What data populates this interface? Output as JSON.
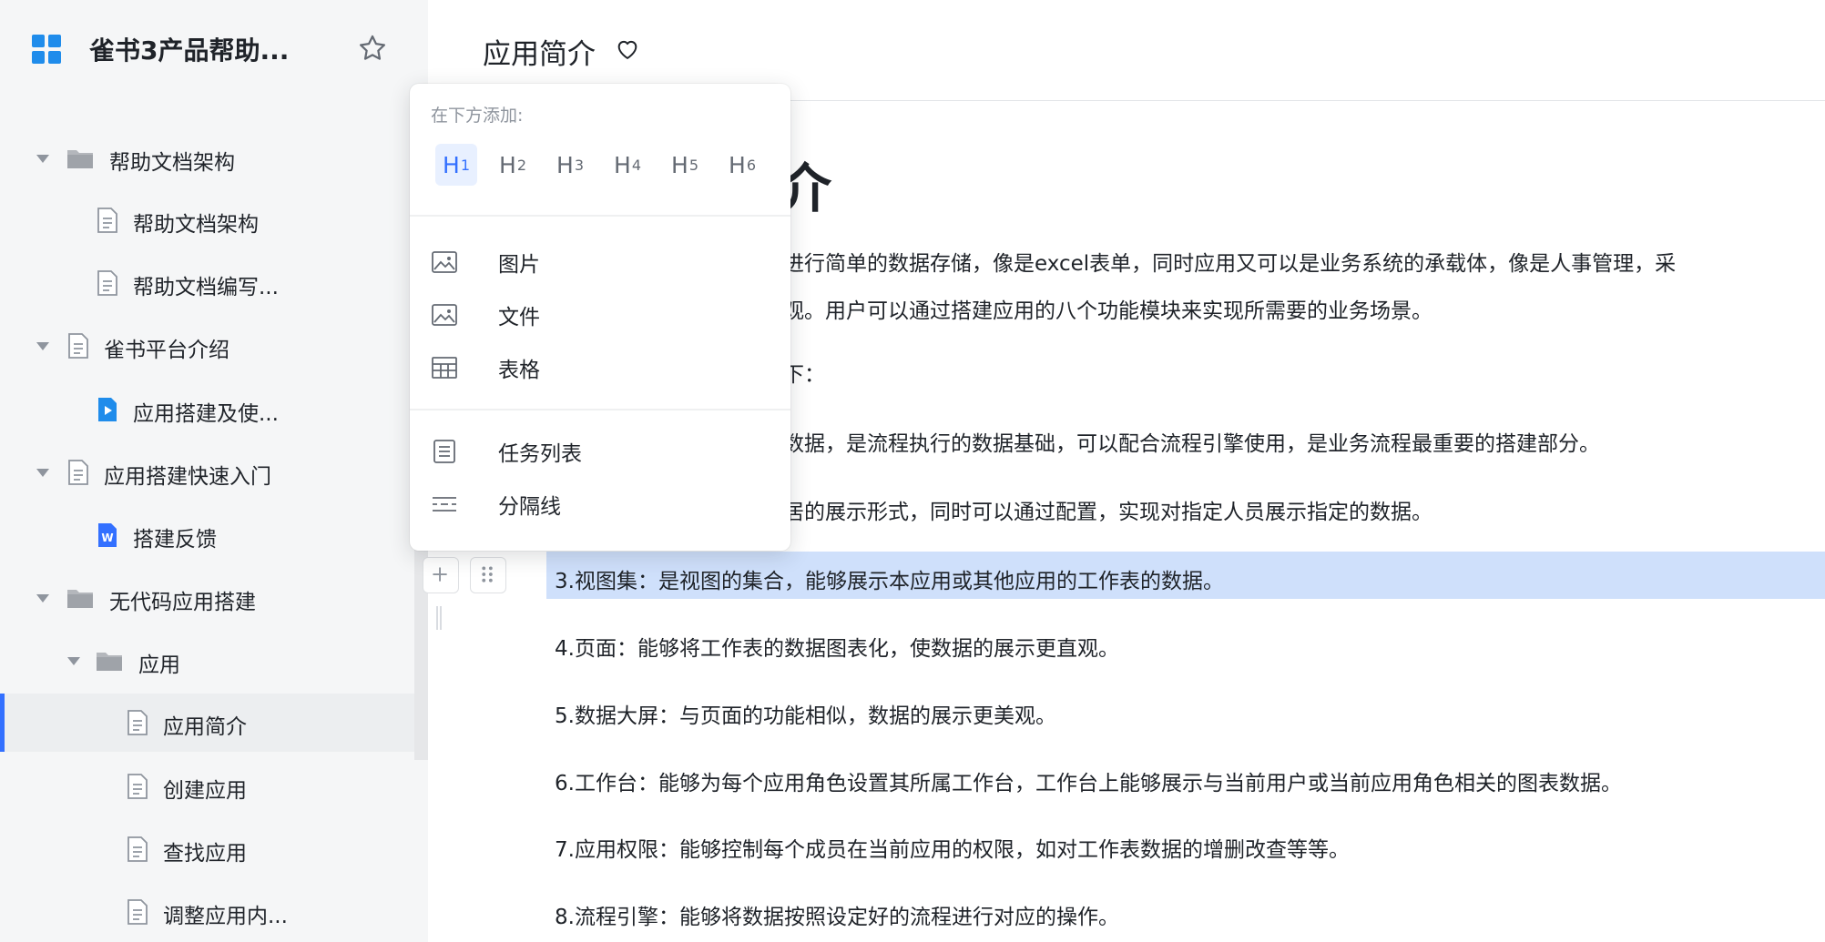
{
  "sidebar": {
    "app_title": "雀书3产品帮助...",
    "items": [
      {
        "label": "帮助文档架构"
      },
      {
        "label": "帮助文档架构"
      },
      {
        "label": "帮助文档编写..."
      },
      {
        "label": "雀书平台介绍"
      },
      {
        "label": "应用搭建及使..."
      },
      {
        "label": "应用搭建快速入门"
      },
      {
        "label": "搭建反馈"
      },
      {
        "label": "无代码应用搭建"
      },
      {
        "label": "应用"
      },
      {
        "label": "应用简介"
      },
      {
        "label": "创建应用"
      },
      {
        "label": "查找应用"
      },
      {
        "label": "调整应用内..."
      }
    ]
  },
  "header": {
    "title": "应用简介"
  },
  "document": {
    "heading_fragment": "介",
    "paragraphs": [
      "进行简单的数据存储，像是excel表单，同时应用又可以是业务系统的承载体，像是人事管理，采",
      "观。用户可以通过搭建应用的八个功能模块来实现所需要的业务场景。",
      "下：",
      "数据，是流程执行的数据基础，可以配合流程引擎使用，是业务流程最重要的搭建部分。",
      "居的展示形式，同时可以通过配置，实现对指定人员展示指定的数据。",
      "3.视图集：是视图的集合，能够展示本应用或其他应用的工作表的数据。",
      "4.页面：能够将工作表的数据图表化，使数据的展示更直观。",
      "5.数据大屏：与页面的功能相似，数据的展示更美观。",
      "6.工作台：能够为每个应用角色设置其所属工作台，工作台上能够展示与当前用户或当前应用角色相关的图表数据。",
      "7.应用权限：能够控制每个成员在当前应用的权限，如对工作表数据的增删改查等等。",
      "8.流程引擎：能够将数据按照设定好的流程进行对应的操作。"
    ]
  },
  "insert_popup": {
    "caption": "在下方添加:",
    "headings": [
      {
        "letter": "H",
        "level": "1"
      },
      {
        "letter": "H",
        "level": "2"
      },
      {
        "letter": "H",
        "level": "3"
      },
      {
        "letter": "H",
        "level": "4"
      },
      {
        "letter": "H",
        "level": "5"
      },
      {
        "letter": "H",
        "level": "6"
      }
    ],
    "media_items": [
      {
        "label": "图片",
        "icon": "image-icon"
      },
      {
        "label": "文件",
        "icon": "file-image-icon"
      },
      {
        "label": "表格",
        "icon": "table-icon"
      }
    ],
    "other_items": [
      {
        "label": "任务列表",
        "icon": "task-list-icon"
      },
      {
        "label": "分隔线",
        "icon": "divider-icon"
      }
    ]
  },
  "colors": {
    "accent": "#3370ff",
    "highlight": "#cfe0fb",
    "sidebar_bg": "#f5f6f7"
  }
}
